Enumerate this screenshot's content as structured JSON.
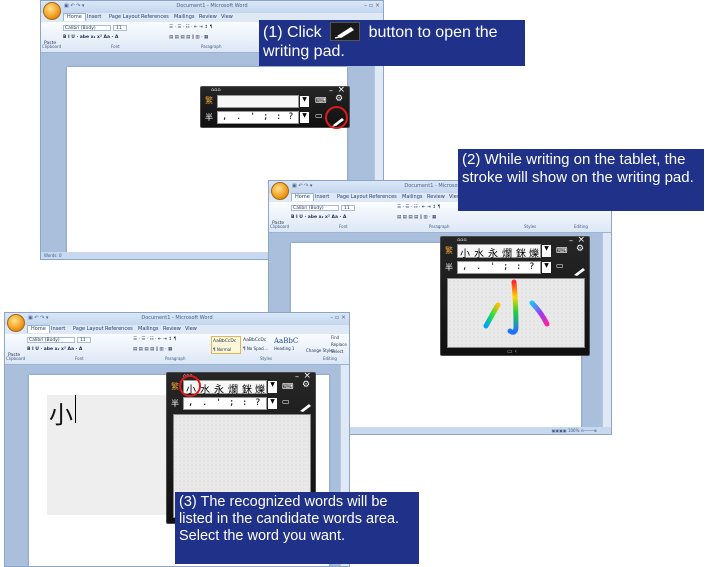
{
  "word_app": {
    "title": "Document1 - Microsoft Word",
    "window_controls": "–  ▫  ×",
    "tabs": [
      "Home",
      "Insert",
      "Page Layout",
      "References",
      "Mailings",
      "Review",
      "View"
    ],
    "font_name": "Calibri (Body)",
    "font_size": "11",
    "paste_label": "Paste",
    "groups": [
      "Clipboard",
      "Font",
      "Paragraph",
      "Styles",
      "Editing"
    ],
    "styles": [
      "AaBbCcDc",
      "AaBbCcDc",
      "AaBbC"
    ],
    "style_names": [
      "¶ Normal",
      "¶ No Spaci...",
      "Heading 1"
    ],
    "change_styles": "Change Styles",
    "editing_items": [
      "Find",
      "Replace",
      "Select"
    ],
    "status_words": "Words: 0"
  },
  "writing_pad": {
    "candidates_step2": [
      "小",
      "水",
      "永",
      "爛",
      "銤",
      "爍"
    ],
    "candidates_step3": [
      "小",
      "水",
      "永",
      "爛",
      "銤",
      "爍"
    ],
    "punctuation": [
      ",",
      ".",
      "'",
      ";",
      ":",
      "?"
    ],
    "keyboard_icon": "keyboard-icon",
    "settings_icon": "gear-icon",
    "pen_icon": "pen-icon",
    "close_label": "×",
    "minimize_label": "–",
    "typed_text": "小"
  },
  "callouts": {
    "step1_before": "(1) Click",
    "step1_after": "button to open the writing pad.",
    "step2": "(2) While writing on the tablet, the stroke will show on the writing pad.",
    "step3": "(3) The recognized words will be listed in the candidate words area. Select the word you want."
  },
  "colors": {
    "callout_bg": "#1f3189",
    "highlight_ring": "#e0191b",
    "pad_bg": "#1a1a1a"
  }
}
